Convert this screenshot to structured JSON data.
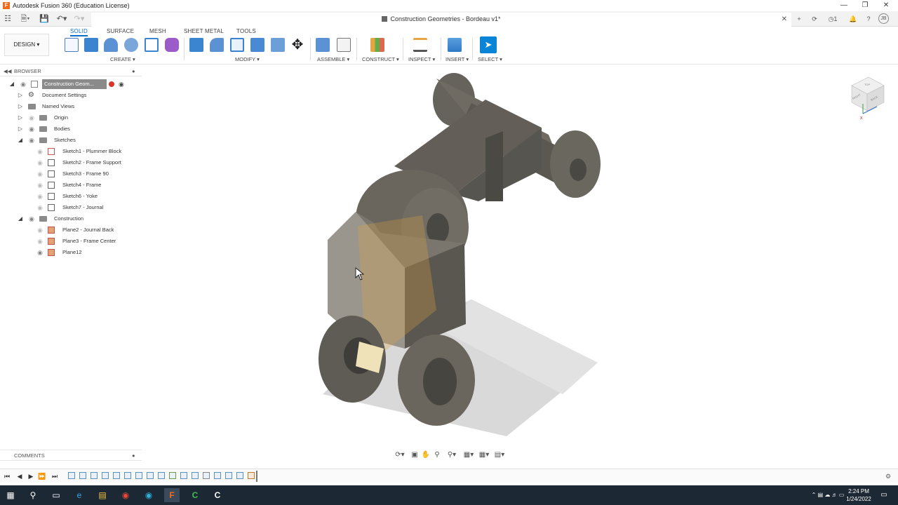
{
  "window": {
    "title": "Autodesk Fusion 360 (Education License)",
    "document_tab": "Construction Geometries - Bordeau v1*",
    "user_initials": "JB",
    "job_count": "1"
  },
  "toolbar": {
    "workspace": "DESIGN",
    "tabs": [
      "SOLID",
      "SURFACE",
      "MESH",
      "SHEET METAL",
      "TOOLS"
    ],
    "groups": {
      "create": "CREATE",
      "modify": "MODIFY",
      "assemble": "ASSEMBLE",
      "construct": "CONSTRUCT",
      "inspect": "INSPECT",
      "insert": "INSERT",
      "select": "SELECT"
    },
    "accent_color": "#0a6ec8"
  },
  "browser": {
    "title": "BROWSER",
    "root": "Construction Geom...",
    "items": [
      {
        "label": "Document Settings"
      },
      {
        "label": "Named Views"
      },
      {
        "label": "Origin"
      },
      {
        "label": "Bodies"
      },
      {
        "label": "Sketches"
      },
      {
        "label": "Sketch1 - Plummer Block"
      },
      {
        "label": "Sketch2 - Frame Support"
      },
      {
        "label": "Sketch3 - Frame 90"
      },
      {
        "label": "Sketch4 - Frame"
      },
      {
        "label": "Sketch6 - Yoke"
      },
      {
        "label": "Sketch7 - Journal"
      },
      {
        "label": "Construction"
      },
      {
        "label": "Plane2 - Journal Back"
      },
      {
        "label": "Plane3 - Frame Center"
      },
      {
        "label": "Plane12"
      }
    ]
  },
  "comments": {
    "title": "COMMENTS"
  },
  "viewcube": {
    "faces": [
      "RIGHT",
      "BACK",
      "TOP"
    ]
  },
  "taskbar": {
    "time": "2:24 PM",
    "date": "1/24/2022"
  }
}
